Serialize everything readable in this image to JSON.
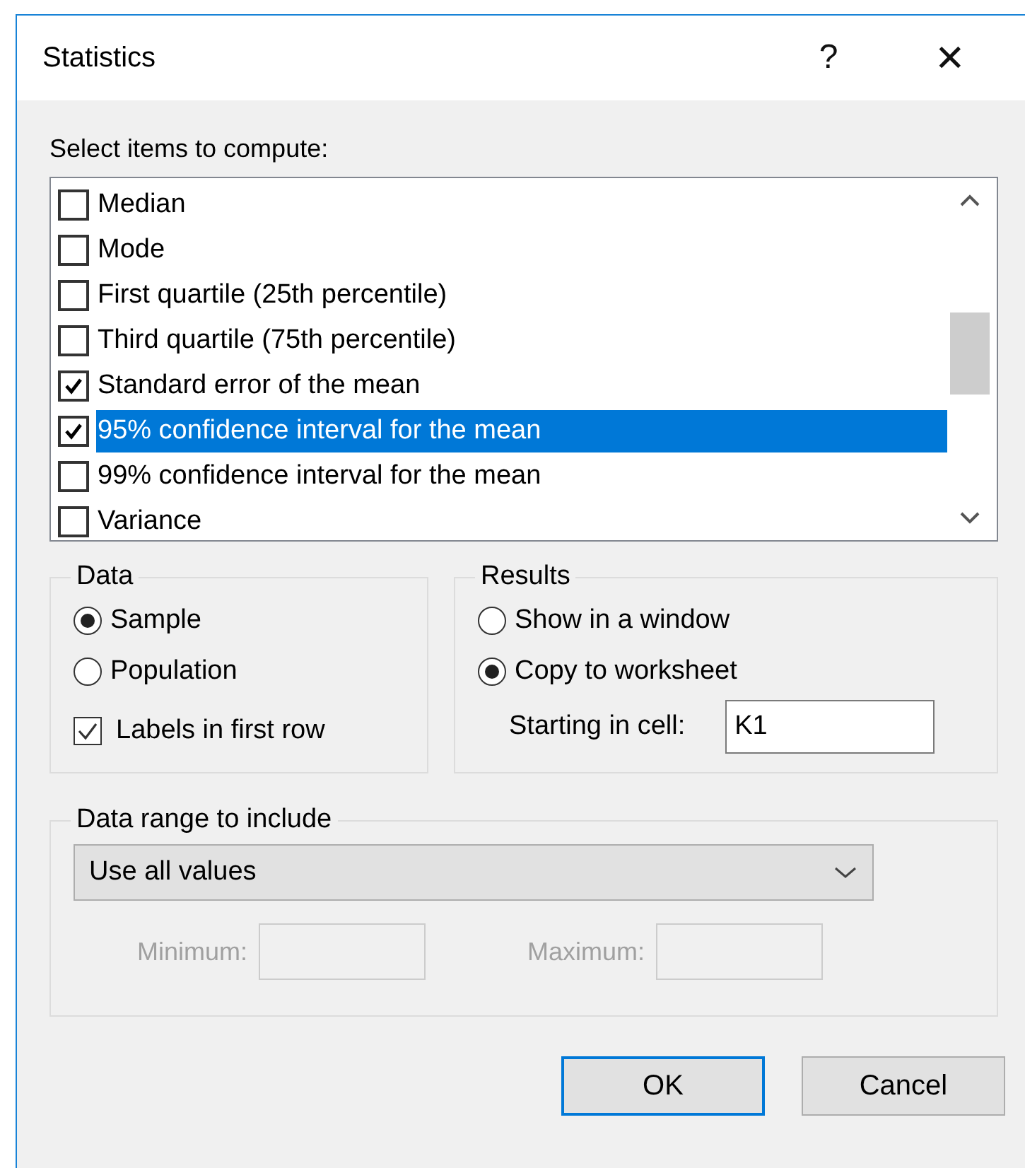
{
  "window": {
    "title": "Statistics",
    "help": "?",
    "close": "✕"
  },
  "items_label": "Select items to compute:",
  "items": [
    {
      "label": "Median",
      "checked": false,
      "selected": false
    },
    {
      "label": "Mode",
      "checked": false,
      "selected": false
    },
    {
      "label": "First quartile (25th percentile)",
      "checked": false,
      "selected": false
    },
    {
      "label": "Third quartile (75th percentile)",
      "checked": false,
      "selected": false
    },
    {
      "label": "Standard error of the mean",
      "checked": true,
      "selected": false
    },
    {
      "label": "95% confidence interval for the mean",
      "checked": true,
      "selected": true
    },
    {
      "label": "99% confidence interval for the mean",
      "checked": false,
      "selected": false
    },
    {
      "label": "Variance",
      "checked": false,
      "selected": false
    }
  ],
  "data_group": {
    "title": "Data",
    "options": [
      {
        "label": "Sample",
        "selected": true
      },
      {
        "label": "Population",
        "selected": false
      }
    ],
    "labels_in_first_row": {
      "label": "Labels in first row",
      "checked": true
    }
  },
  "results_group": {
    "title": "Results",
    "options": [
      {
        "label": "Show in a window",
        "selected": false
      },
      {
        "label": "Copy to worksheet",
        "selected": true
      }
    ],
    "start_cell": {
      "label": "Starting in cell:",
      "value": "K1"
    }
  },
  "range_group": {
    "title": "Data range to include",
    "combo": {
      "value": "Use all values"
    },
    "minimum": {
      "label": "Minimum:",
      "disabled": true
    },
    "maximum": {
      "label": "Maximum:",
      "disabled": true
    }
  },
  "buttons": [
    {
      "label": "OK",
      "default": true
    },
    {
      "label": "Cancel",
      "default": false
    }
  ]
}
